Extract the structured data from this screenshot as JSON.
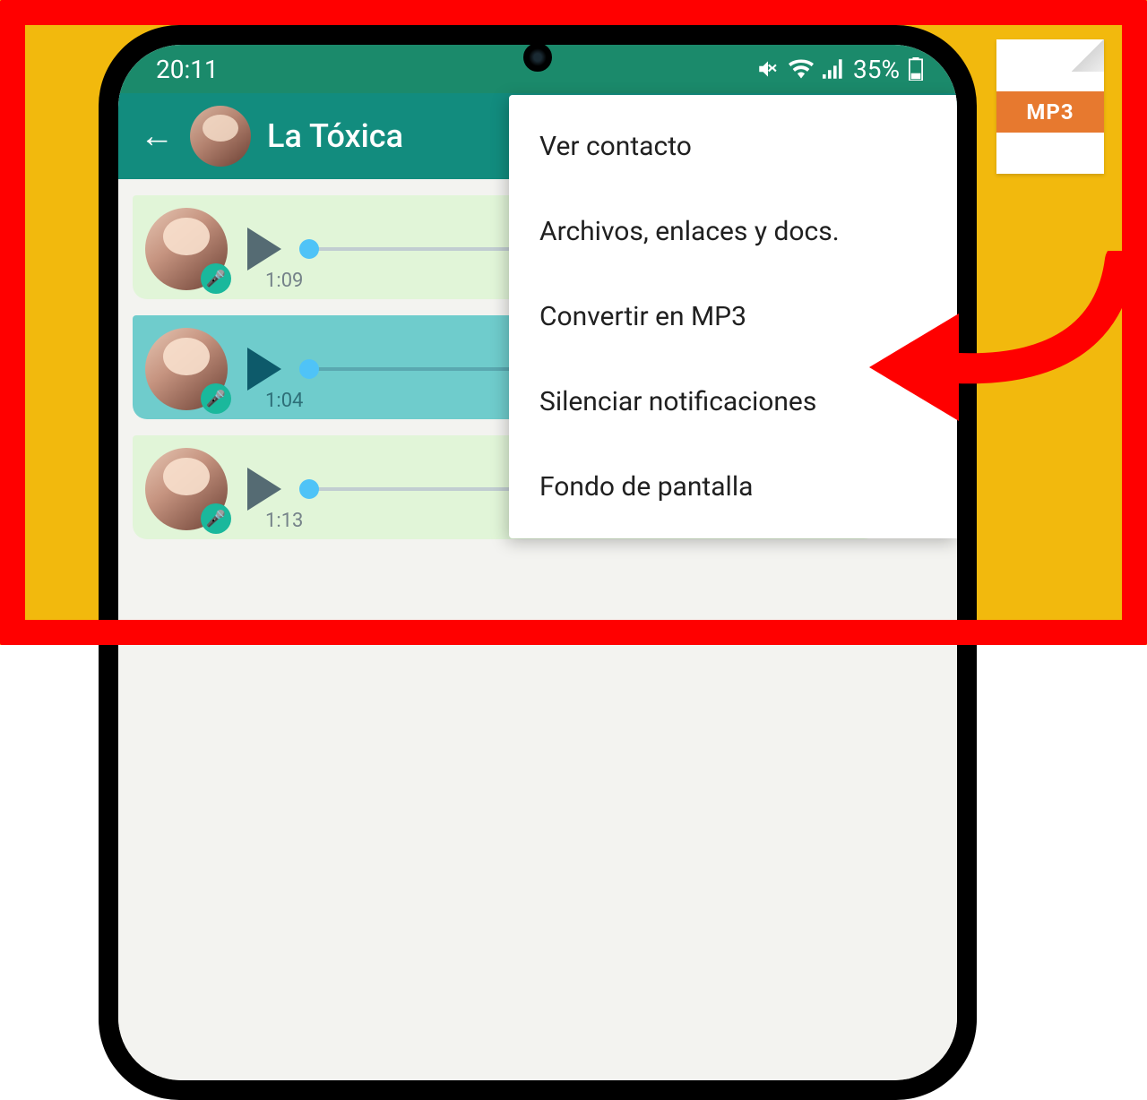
{
  "statusbar": {
    "time": "20:11",
    "battery_text": "35%"
  },
  "header": {
    "contact_name": "La Tóxica"
  },
  "messages": [
    {
      "duration": "1:09",
      "selected": false
    },
    {
      "duration": "1:04",
      "selected": true
    },
    {
      "duration": "1:13",
      "selected": false
    }
  ],
  "menu": {
    "items": [
      "Ver contacto",
      "Archivos, enlaces y docs.",
      "Convertir en MP3",
      "Silenciar notificaciones",
      "Fondo de pantalla"
    ]
  },
  "mp3_icon": {
    "label": "MP3"
  }
}
